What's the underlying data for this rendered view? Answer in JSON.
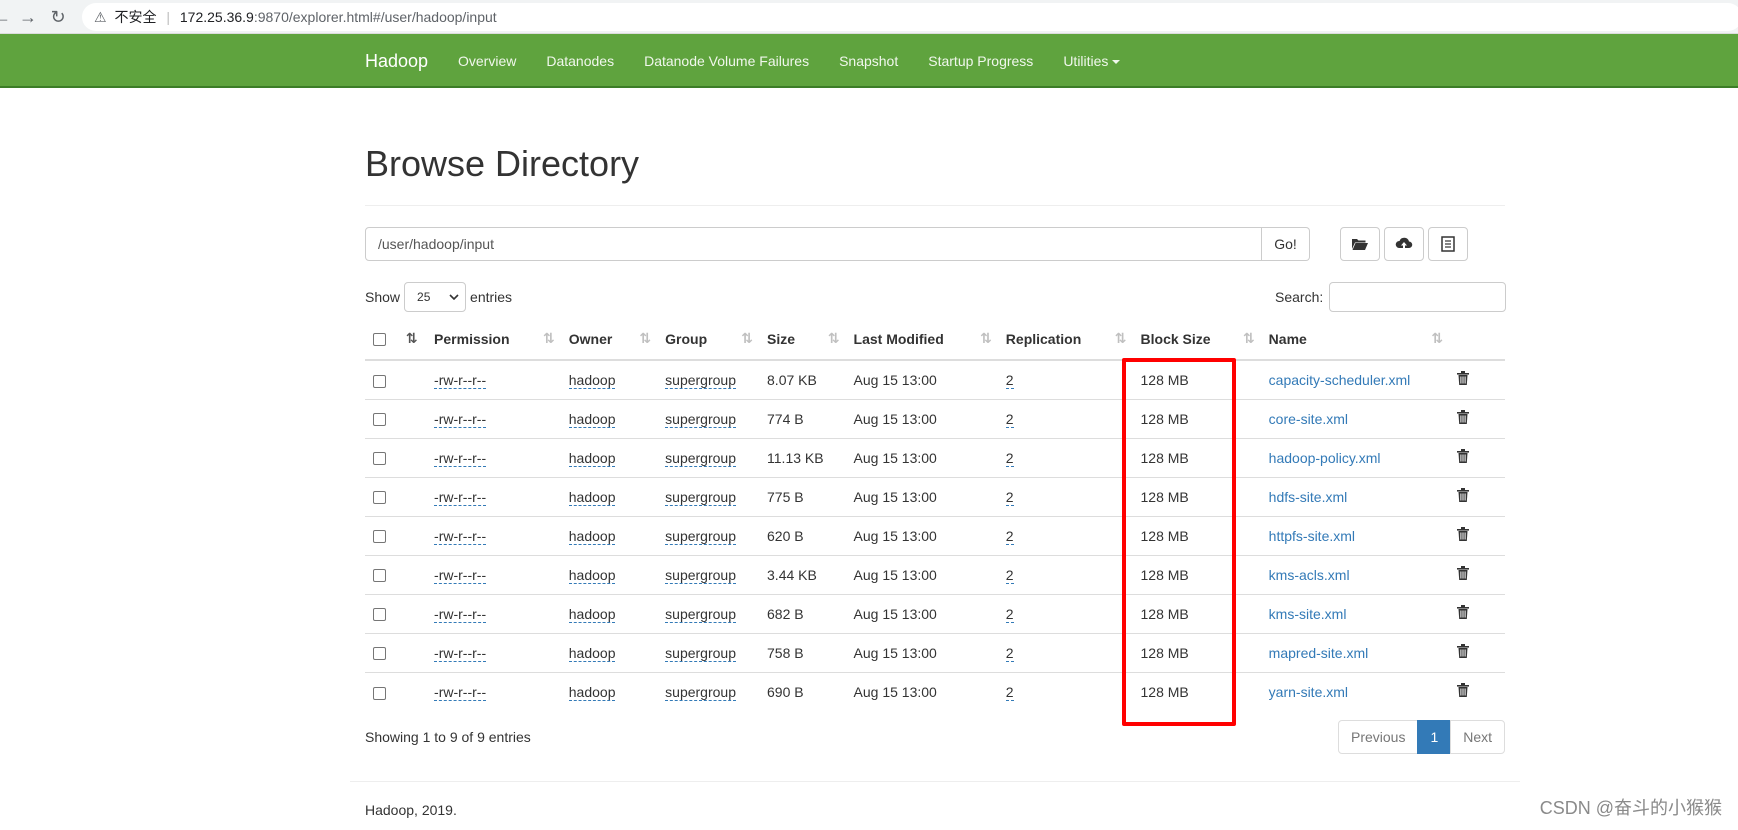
{
  "browser": {
    "insecure_label": "不安全",
    "url_host": "172.25.36.9",
    "url_rest": ":9870/explorer.html#/user/hadoop/input"
  },
  "navbar": {
    "brand": "Hadoop",
    "items": [
      {
        "label": "Overview"
      },
      {
        "label": "Datanodes"
      },
      {
        "label": "Datanode Volume Failures"
      },
      {
        "label": "Snapshot"
      },
      {
        "label": "Startup Progress"
      },
      {
        "label": "Utilities"
      }
    ]
  },
  "page": {
    "title": "Browse Directory",
    "path_value": "/user/hadoop/input",
    "go_label": "Go!",
    "show_label": "Show",
    "page_length": "25",
    "entries_label": "entries",
    "search_label": "Search:",
    "info": "Showing 1 to 9 of 9 entries",
    "pager": {
      "previous": "Previous",
      "current": "1",
      "next": "Next"
    },
    "footer": "Hadoop, 2019.",
    "watermark": "CSDN @奋斗的小猴猴"
  },
  "table": {
    "headers": {
      "permission": "Permission",
      "owner": "Owner",
      "group": "Group",
      "size": "Size",
      "last_modified": "Last Modified",
      "replication": "Replication",
      "block_size": "Block Size",
      "name": "Name"
    },
    "rows": [
      {
        "permission": "-rw-r--r--",
        "owner": "hadoop",
        "group": "supergroup",
        "size": "8.07 KB",
        "last_modified": "Aug 15 13:00",
        "replication": "2",
        "block_size": "128 MB",
        "name": "capacity-scheduler.xml"
      },
      {
        "permission": "-rw-r--r--",
        "owner": "hadoop",
        "group": "supergroup",
        "size": "774 B",
        "last_modified": "Aug 15 13:00",
        "replication": "2",
        "block_size": "128 MB",
        "name": "core-site.xml"
      },
      {
        "permission": "-rw-r--r--",
        "owner": "hadoop",
        "group": "supergroup",
        "size": "11.13 KB",
        "last_modified": "Aug 15 13:00",
        "replication": "2",
        "block_size": "128 MB",
        "name": "hadoop-policy.xml"
      },
      {
        "permission": "-rw-r--r--",
        "owner": "hadoop",
        "group": "supergroup",
        "size": "775 B",
        "last_modified": "Aug 15 13:00",
        "replication": "2",
        "block_size": "128 MB",
        "name": "hdfs-site.xml"
      },
      {
        "permission": "-rw-r--r--",
        "owner": "hadoop",
        "group": "supergroup",
        "size": "620 B",
        "last_modified": "Aug 15 13:00",
        "replication": "2",
        "block_size": "128 MB",
        "name": "httpfs-site.xml"
      },
      {
        "permission": "-rw-r--r--",
        "owner": "hadoop",
        "group": "supergroup",
        "size": "3.44 KB",
        "last_modified": "Aug 15 13:00",
        "replication": "2",
        "block_size": "128 MB",
        "name": "kms-acls.xml"
      },
      {
        "permission": "-rw-r--r--",
        "owner": "hadoop",
        "group": "supergroup",
        "size": "682 B",
        "last_modified": "Aug 15 13:00",
        "replication": "2",
        "block_size": "128 MB",
        "name": "kms-site.xml"
      },
      {
        "permission": "-rw-r--r--",
        "owner": "hadoop",
        "group": "supergroup",
        "size": "758 B",
        "last_modified": "Aug 15 13:00",
        "replication": "2",
        "block_size": "128 MB",
        "name": "mapred-site.xml"
      },
      {
        "permission": "-rw-r--r--",
        "owner": "hadoop",
        "group": "supergroup",
        "size": "690 B",
        "last_modified": "Aug 15 13:00",
        "replication": "2",
        "block_size": "128 MB",
        "name": "yarn-site.xml"
      }
    ]
  },
  "colors": {
    "navbar": "#5fa33e",
    "link": "#337ab7",
    "highlight": "#ff0000"
  },
  "icons": [
    "back-arrow-icon",
    "forward-arrow-icon",
    "reload-icon",
    "warning-icon",
    "folder-open-icon",
    "cloud-upload-icon",
    "list-icon",
    "sort-icon",
    "trash-icon"
  ]
}
